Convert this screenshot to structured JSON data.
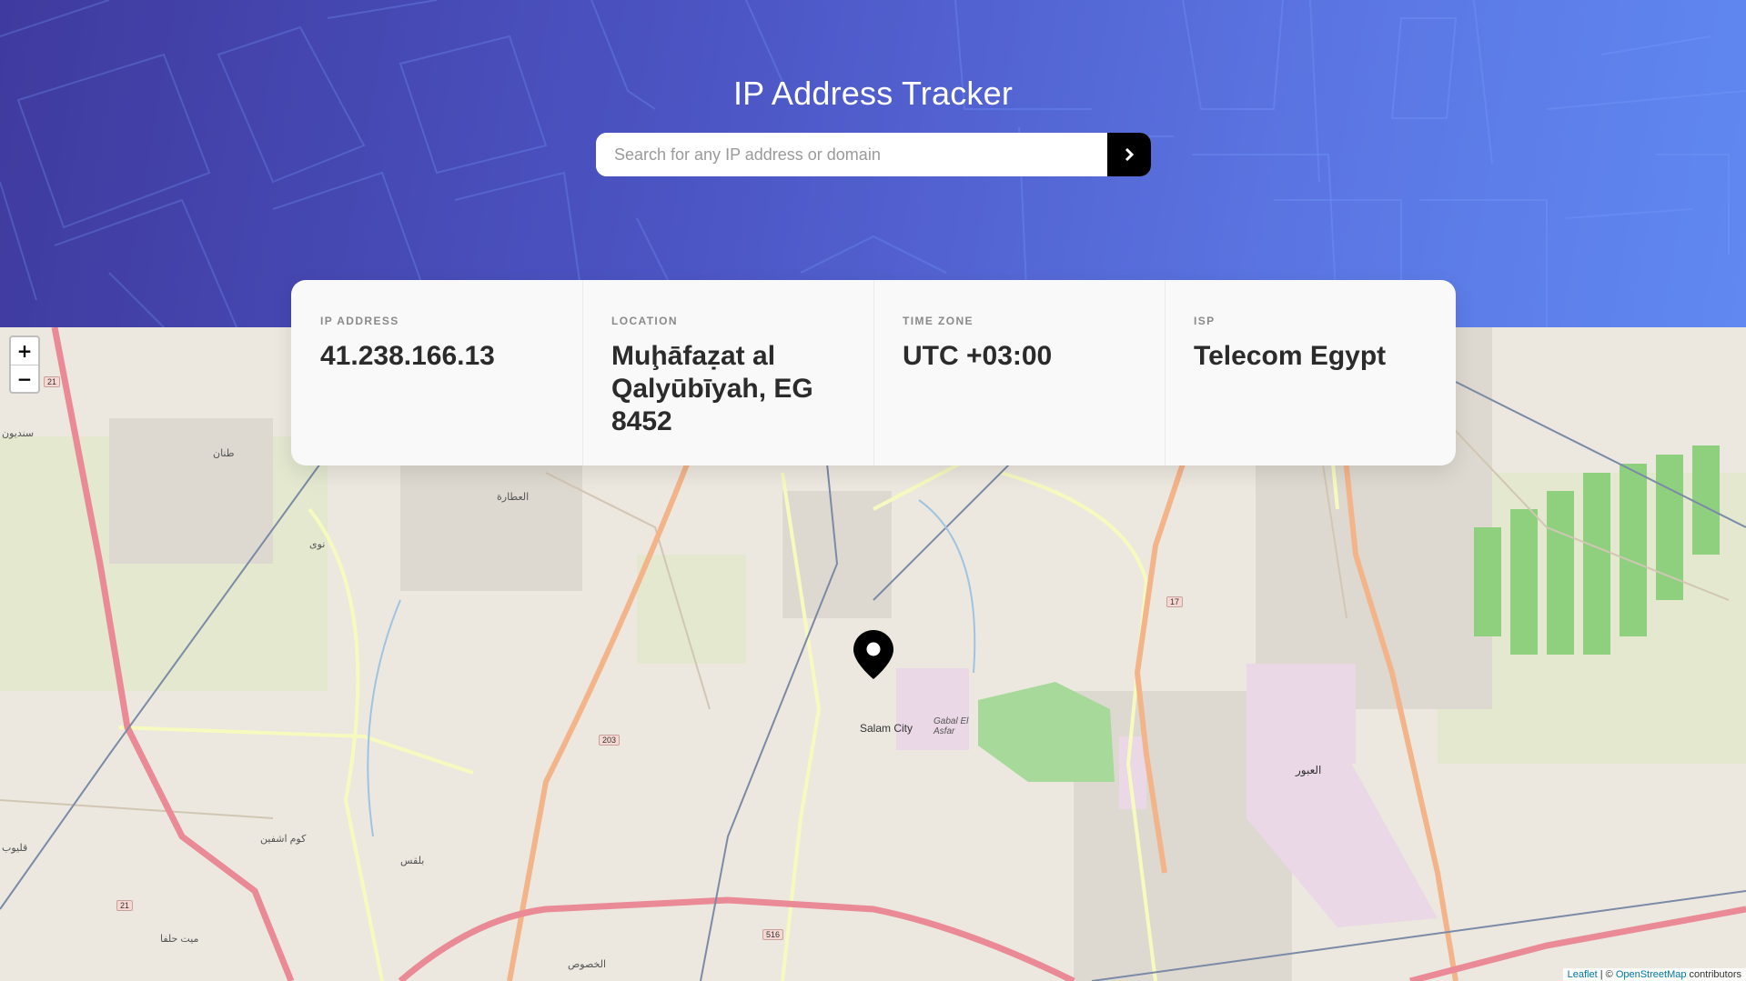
{
  "header": {
    "title": "IP Address Tracker",
    "search_placeholder": "Search for any IP address or domain",
    "search_value": "",
    "submit_icon": "chevron-right-icon"
  },
  "info": [
    {
      "label": "IP ADDRESS",
      "value": "41.238.166.13"
    },
    {
      "label": "LOCATION",
      "value": "Muḩāfaẓat al Qalyūbīyah, EG 8452"
    },
    {
      "label": "TIME ZONE",
      "value": "UTC +03:00"
    },
    {
      "label": "ISP",
      "value": "Telecom Egypt"
    }
  ],
  "map": {
    "zoom_in": "+",
    "zoom_out": "−",
    "marker_icon": "location-pin-icon",
    "labels": {
      "salam_city": "Salam City",
      "gabal_el_asfar": "Gabal El Asfar",
      "obour": "العبور",
      "qalyub": "قليوب",
      "bilqas": "بلقس",
      "kafr_ashmawy": "كوم اشفين",
      "mit_halfa": "ميت حلفا",
      "al_khusus": "الخصوص",
      "al_atara": "العطارة",
      "tanan": "طنان",
      "nawa": "نوى",
      "sindioun": "سنديون"
    },
    "shields": {
      "r21a": "21",
      "r21b": "21",
      "r203": "203",
      "r516": "516",
      "r17": "17"
    },
    "attribution": {
      "leaflet": "Leaflet",
      "separator": " | © ",
      "osm": "OpenStreetMap",
      "suffix": " contributors"
    }
  },
  "colors": {
    "header_gradient_start": "#3f3a9e",
    "header_gradient_end": "#6088f0",
    "card_bg": "#f9f9f9",
    "button_bg": "#000000"
  }
}
